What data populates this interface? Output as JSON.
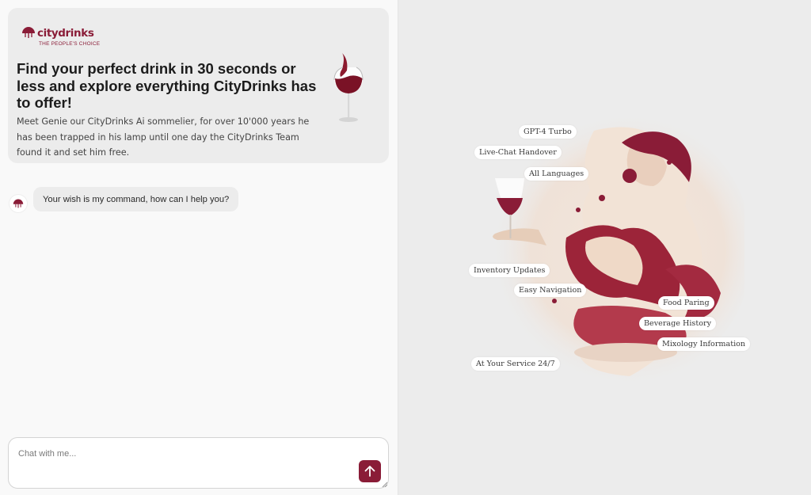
{
  "brand": {
    "name": "citydrinks",
    "tagline": "THE PEOPLE'S CHOICE",
    "color": "#8a1c37"
  },
  "hero": {
    "headline": "Find your perfect drink in 30 seconds or less and explore everything CityDrinks has to offer!",
    "intro": "Meet Genie our CityDrinks Ai sommelier, for over 10'000 years he has been trapped in his lamp until one day the CityDrinks Team found it and set him free."
  },
  "chat": {
    "messages": [
      {
        "sender": "genie",
        "text": "Your wish is my command, how can I help you?"
      }
    ]
  },
  "composer": {
    "placeholder": "Chat with me...",
    "value": "",
    "send_icon": "arrow-up-icon"
  },
  "features": [
    "GPT-4 Turbo",
    "Live-Chat Handover",
    "All Languages",
    "Inventory Updates",
    "Easy Navigation",
    "Food Paring",
    "Beverage History",
    "Mixology Information",
    "At Your Service 24/7"
  ],
  "colors": {
    "accent": "#8a1c37",
    "panel_left": "#f9f9f9",
    "panel_right": "#ececec",
    "bubble": "#ececec"
  }
}
